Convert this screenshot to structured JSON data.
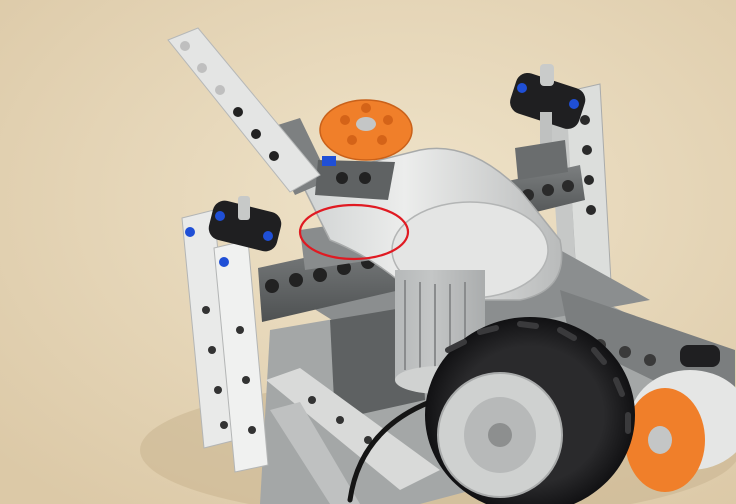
{
  "photo": {
    "subject": "lego-technic-robot-chassis",
    "colors": {
      "background": "#e8d9bd",
      "light_gray": "#d9d9d6",
      "dark_gray": "#6f7273",
      "tire_black": "#1d1d1f",
      "hub_gray": "#c7c9c9",
      "orange": "#f07f2a",
      "pin_blue": "#1f4fd6",
      "annotation_red": "#e01a22"
    },
    "annotation": {
      "shape": "ellipse",
      "color": "#e01a22"
    }
  }
}
